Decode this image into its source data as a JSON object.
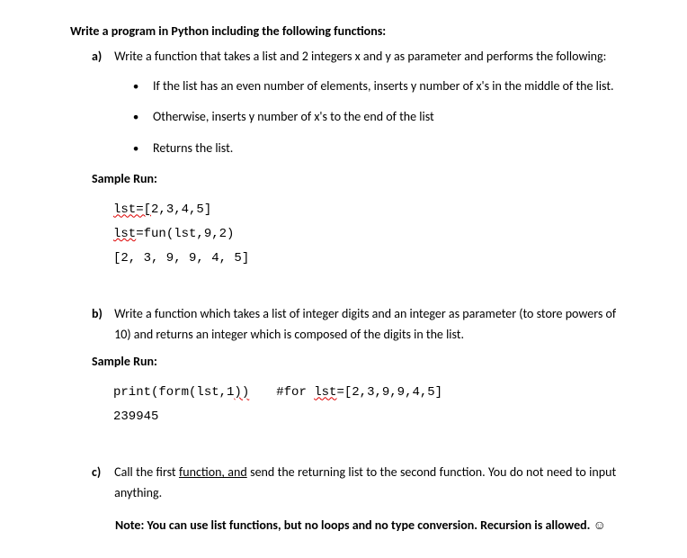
{
  "title": "Write a program in Python including the following functions:",
  "parts": {
    "a": {
      "label": "a)",
      "text": "Write a function that takes a list and 2 integers x and y as parameter and performs the following:",
      "bullets": [
        "If the list has an even number of elements, inserts y number of x's in the middle of the list.",
        "Otherwise, inserts y number of x's to the end of the list",
        "Returns the list."
      ]
    },
    "b": {
      "label": "b)",
      "text": "Write a function which takes a list of integer digits and an integer as parameter (to store powers of 10) and returns an integer which is composed of the digits in the list."
    },
    "c": {
      "label": "c)",
      "text_pre": "Call the first ",
      "text_u": "function, and",
      "text_post": " send the returning list to the second function. You do not need to input anything."
    }
  },
  "sample_label": "Sample Run:",
  "code_a": {
    "l1_sq": "lst=[",
    "l1_rest": "2,3,4,5]",
    "l2_sq": "lst",
    "l2_rest": "=fun(lst,9,2)",
    "l3": "[2, 3, 9, 9, 4, 5]"
  },
  "code_b": {
    "l1_pre": "print(form(lst,1",
    "l1_sq": "))",
    "l1_comment_pre": "#for ",
    "l1_comment_sq": "lst",
    "l1_comment_post": "=[2,3,9,9,4,5]",
    "l2": "239945"
  },
  "note": {
    "text": "Note: You can use list functions, but no loops and no type conversion. Recursion is allowed. ",
    "emoji": "☺"
  }
}
